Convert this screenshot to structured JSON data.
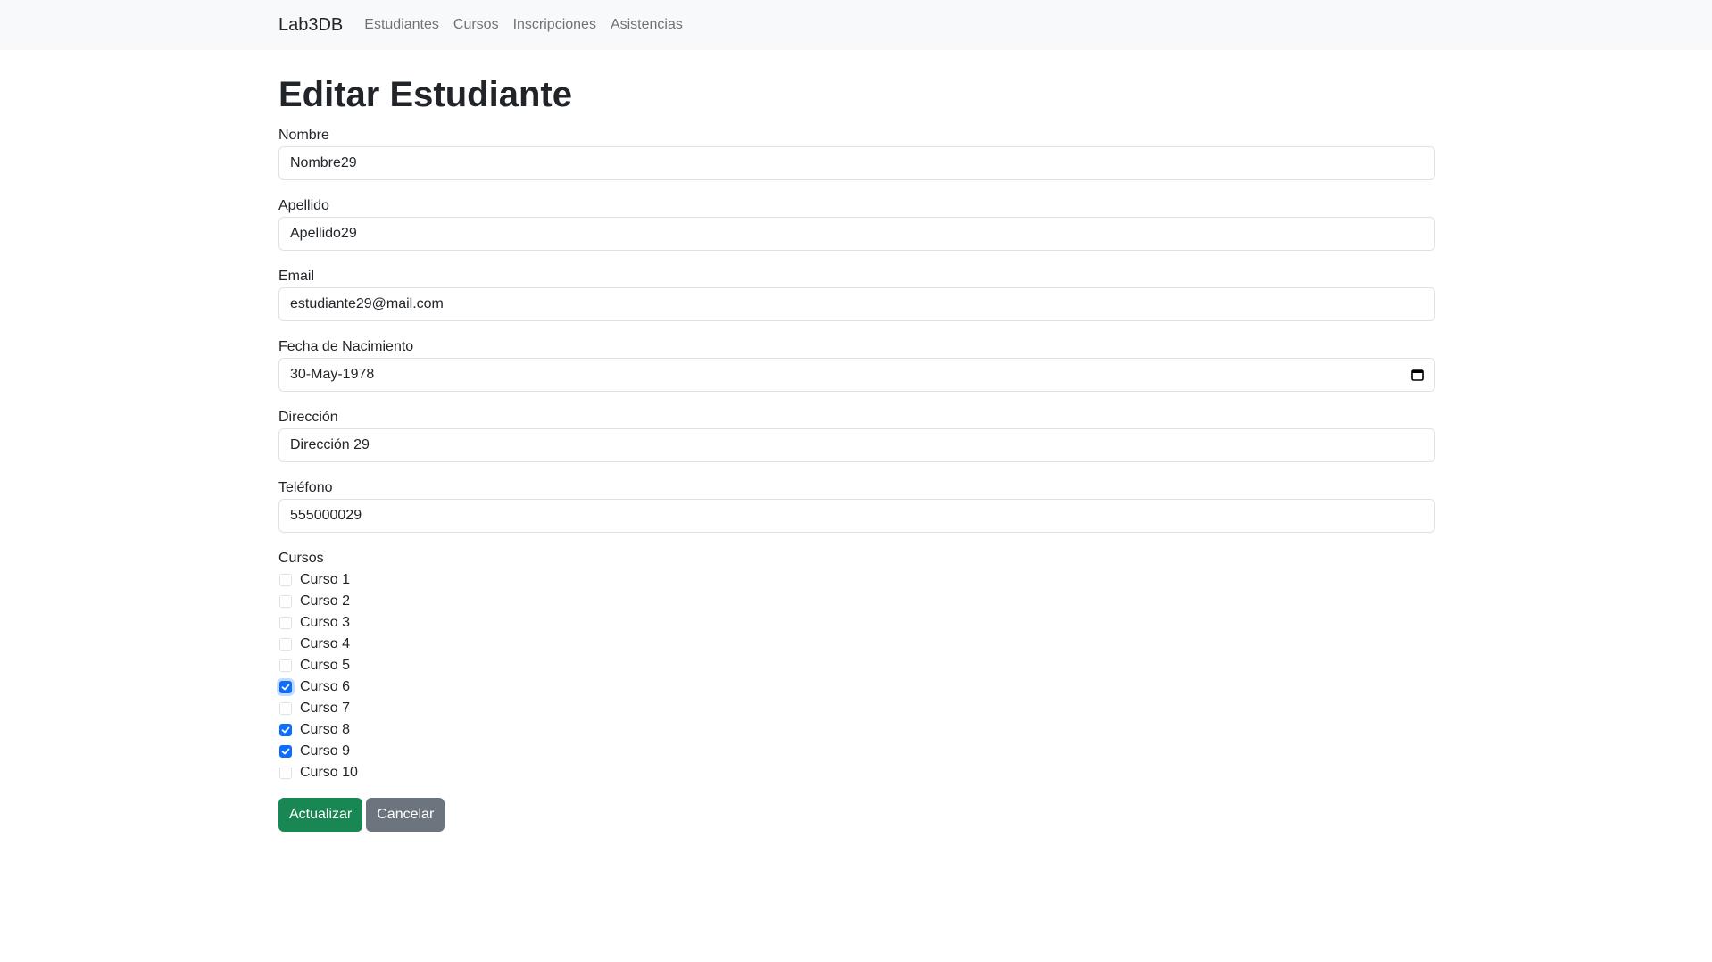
{
  "navbar": {
    "brand": "Lab3DB",
    "links": [
      "Estudiantes",
      "Cursos",
      "Inscripciones",
      "Asistencias"
    ]
  },
  "page": {
    "title": "Editar Estudiante"
  },
  "form": {
    "nombre": {
      "label": "Nombre",
      "value": "Nombre29"
    },
    "apellido": {
      "label": "Apellido",
      "value": "Apellido29"
    },
    "email": {
      "label": "Email",
      "value": "estudiante29@mail.com"
    },
    "fecha": {
      "label": "Fecha de Nacimiento",
      "value": "30-May-1978",
      "icon": "calendar-icon"
    },
    "direccion": {
      "label": "Dirección",
      "value": "Dirección 29"
    },
    "telefono": {
      "label": "Teléfono",
      "value": "555000029"
    },
    "cursos": {
      "label": "Cursos",
      "items": [
        {
          "label": "Curso 1",
          "checked": false
        },
        {
          "label": "Curso 2",
          "checked": false
        },
        {
          "label": "Curso 3",
          "checked": false
        },
        {
          "label": "Curso 4",
          "checked": false
        },
        {
          "label": "Curso 5",
          "checked": false
        },
        {
          "label": "Curso 6",
          "checked": true,
          "focused": true
        },
        {
          "label": "Curso 7",
          "checked": false
        },
        {
          "label": "Curso 8",
          "checked": true
        },
        {
          "label": "Curso 9",
          "checked": true
        },
        {
          "label": "Curso 10",
          "checked": false
        }
      ]
    },
    "actions": {
      "submit": "Actualizar",
      "cancel": "Cancelar"
    }
  },
  "colors": {
    "primary": "#0d6efd",
    "success": "#198754",
    "secondary": "#6c757d",
    "navbar_bg": "#f8f9fa"
  }
}
